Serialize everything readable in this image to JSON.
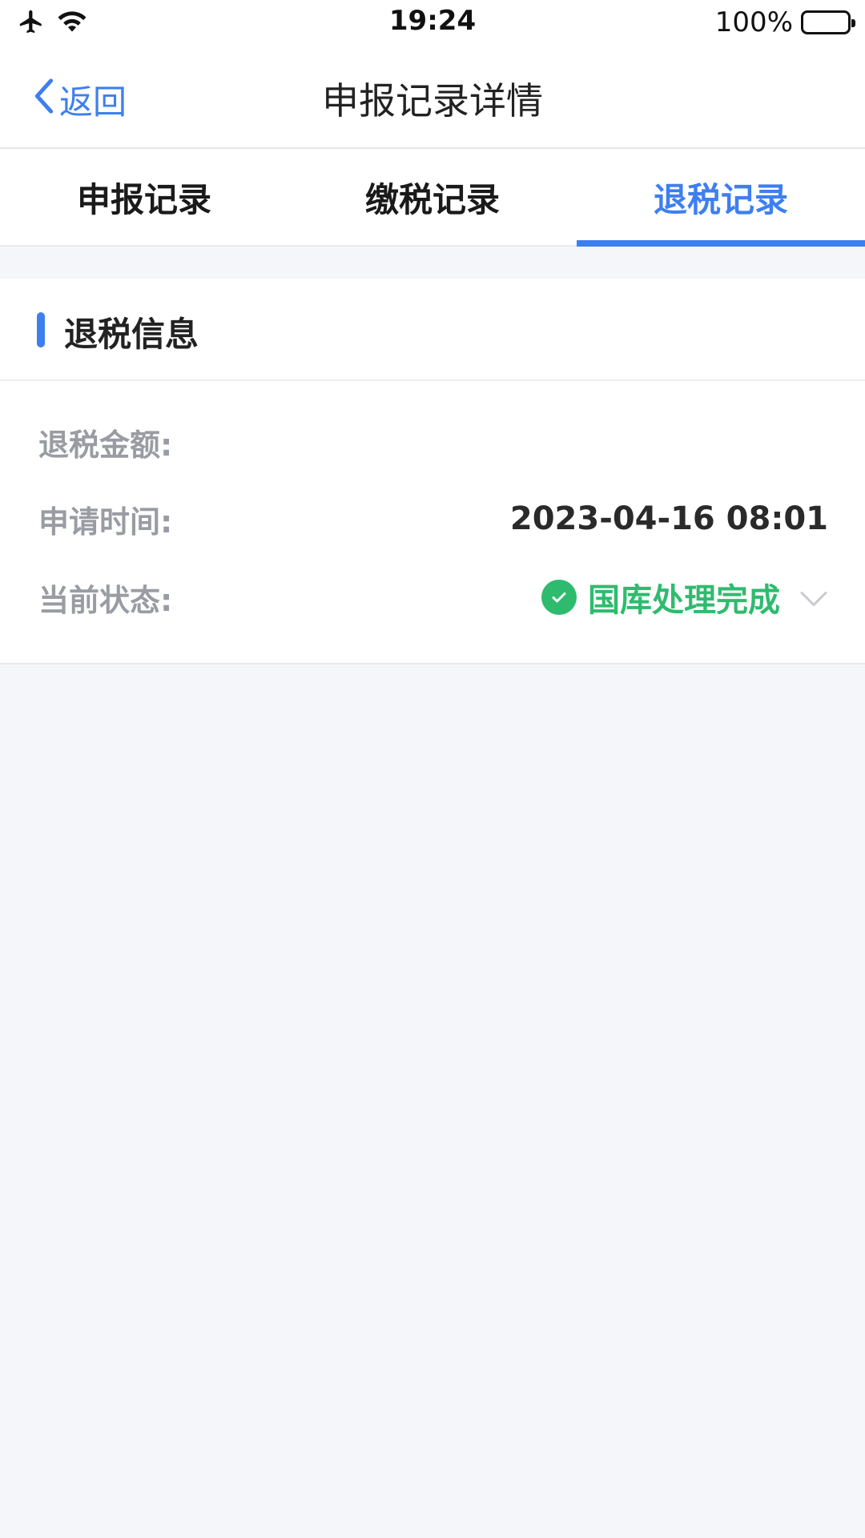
{
  "statusbar": {
    "time": "19:24",
    "battery": "100%",
    "icons": [
      "airplane-icon",
      "wifi-icon",
      "battery-icon"
    ]
  },
  "nav": {
    "back_label": "返回",
    "title": "申报记录详情"
  },
  "tabs": [
    {
      "label": "申报记录",
      "active": false
    },
    {
      "label": "缴税记录",
      "active": false
    },
    {
      "label": "退税记录",
      "active": true
    }
  ],
  "section": {
    "title": "退税信息",
    "rows": [
      {
        "label": "退税金额:",
        "value": ""
      },
      {
        "label": "申请时间:",
        "value": "2023-04-16 08:01"
      },
      {
        "label": "当前状态:",
        "value": "国库处理完成"
      }
    ]
  },
  "colors": {
    "accent": "#3e7ff0",
    "success": "#2fbb6e",
    "background": "#f4f6fa"
  }
}
